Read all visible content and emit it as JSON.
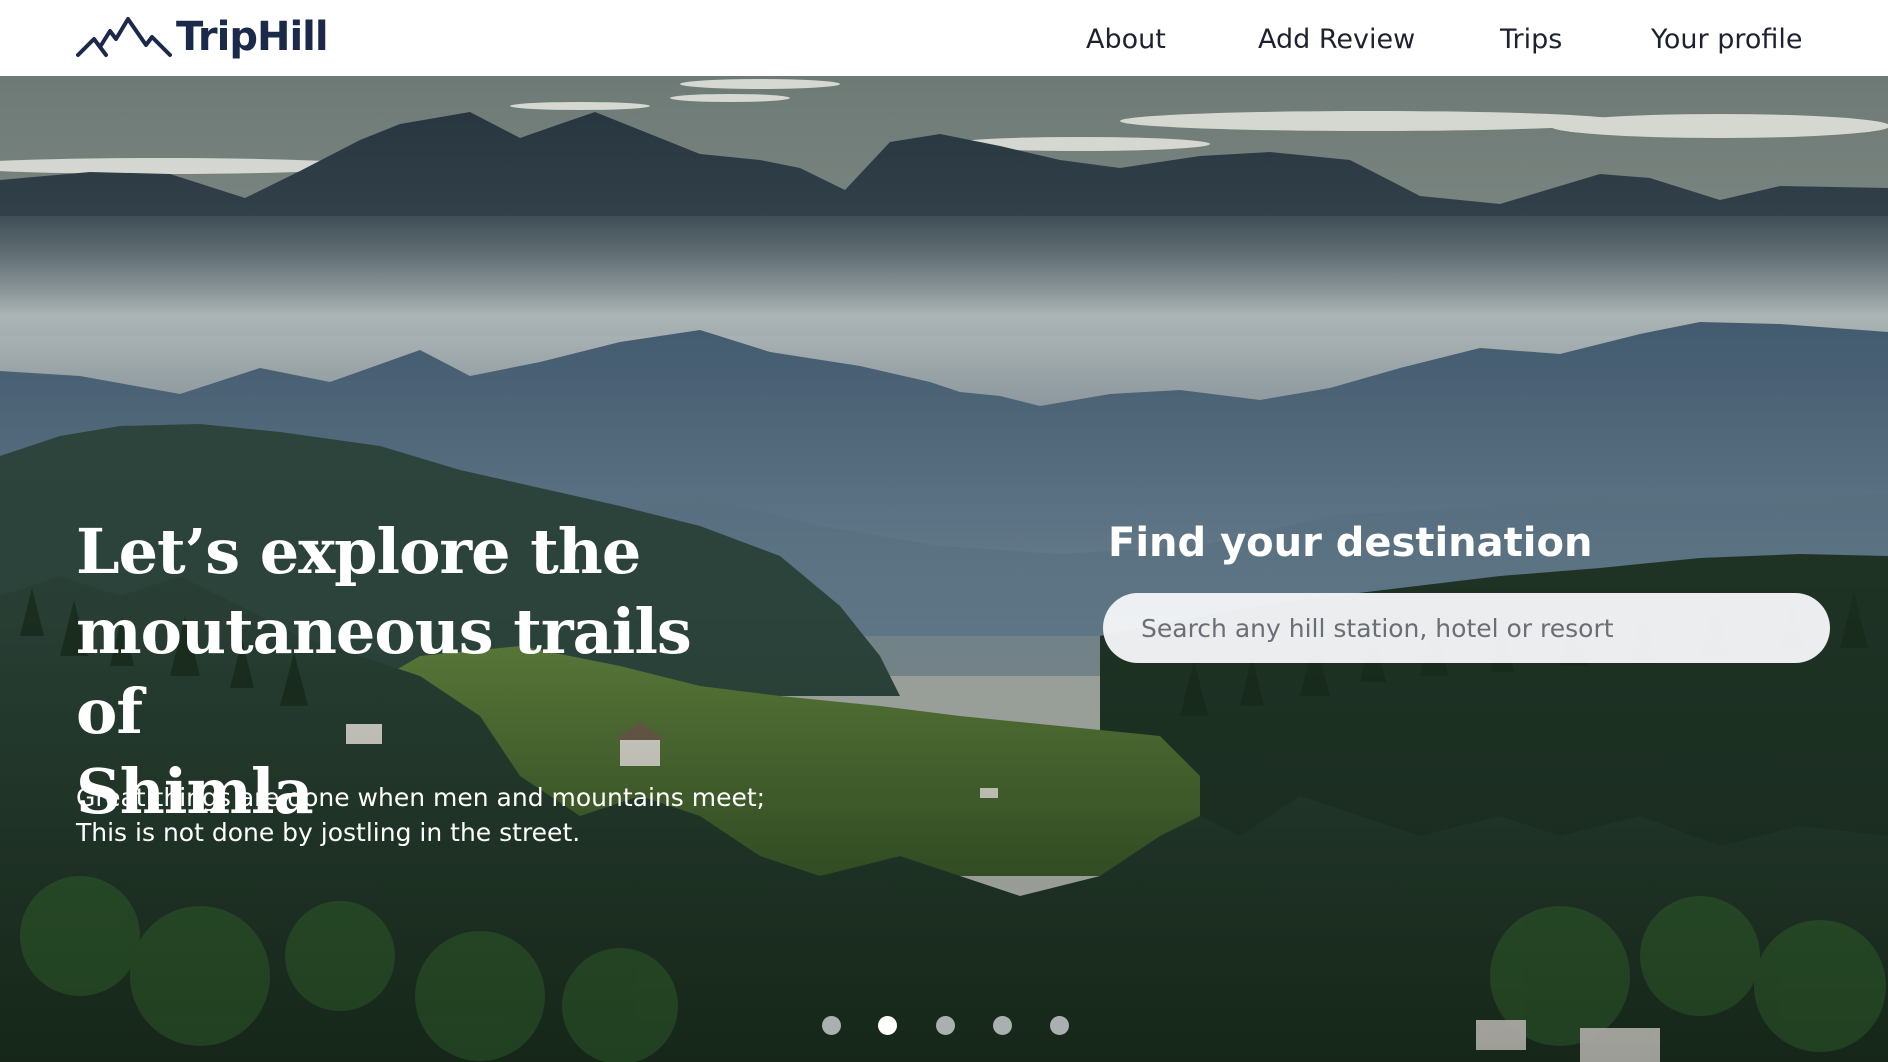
{
  "header": {
    "logo_text": "TripHill",
    "nav": {
      "about": "About",
      "add_review": "Add Review",
      "trips": "Trips",
      "profile": "Your profile"
    }
  },
  "hero": {
    "title_lines": [
      "Let’s explore the",
      "moutaneous trails of",
      "Shimla"
    ],
    "quote_lines": [
      "Great things are done when men and mountains meet;",
      "This is not done by jostling in the street."
    ],
    "background_icon": "misty-mountain-landscape-image"
  },
  "search": {
    "heading": "Find your destination",
    "placeholder": "Search any hill station, hotel or resort",
    "value": ""
  },
  "carousel": {
    "slide_count": 5,
    "active_index": 2
  },
  "colors": {
    "brand_navy": "#1b2a4a",
    "nav_text": "#1e2230",
    "hero_text": "#ffffff"
  }
}
